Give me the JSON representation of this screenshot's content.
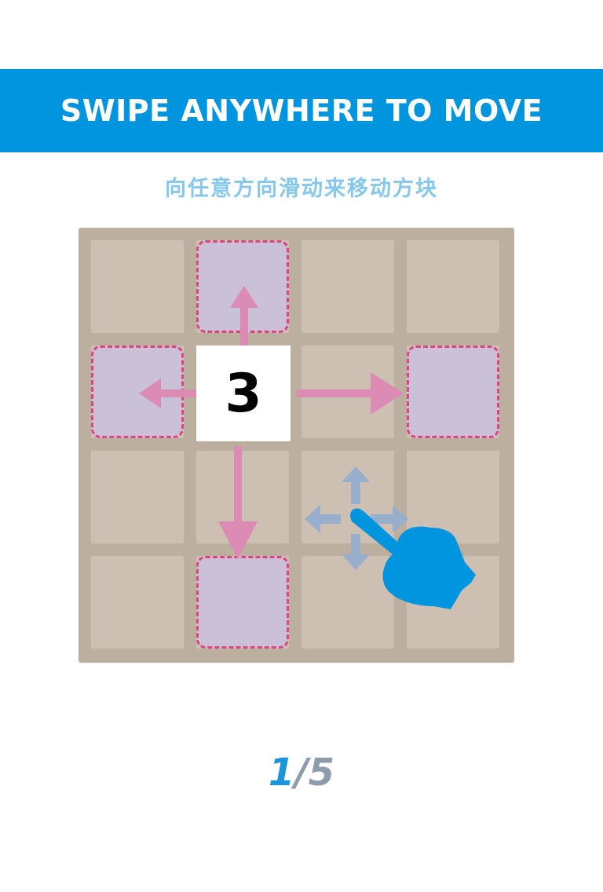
{
  "header": {
    "title": "SWIPE ANYWHERE TO MOVE",
    "subtitle": "向任意方向滑动来移动方块"
  },
  "board": {
    "rows": 4,
    "cols": 4,
    "tile": {
      "value": "3",
      "row": 1,
      "col": 1
    },
    "targets": [
      {
        "row": 0,
        "col": 1
      },
      {
        "row": 1,
        "col": 0
      },
      {
        "row": 1,
        "col": 3
      },
      {
        "row": 3,
        "col": 1
      }
    ]
  },
  "gesture": {
    "hand_icon": "pointing-hand-icon",
    "arrows_icon": "four-way-arrows-icon"
  },
  "colors": {
    "banner": "#0095DE",
    "subtitle": "#86C8EC",
    "board": "#BCAF9F",
    "cell": "#CDC0B2",
    "target_fill": "#CAC0D7",
    "target_border": "#E0457A",
    "arrow": "#DC8CB4",
    "hand": "#0095DE",
    "gesture_arrows": "#97AFCD"
  },
  "pager": {
    "current": "1",
    "separator": "/",
    "total": "5"
  }
}
